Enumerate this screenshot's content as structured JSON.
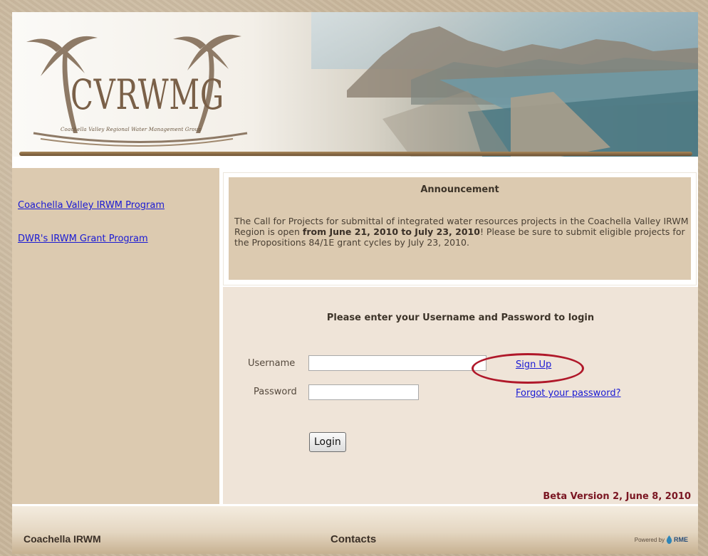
{
  "header": {
    "logo_text": "CVRWMG",
    "logo_subtitle": "Coachella Valley Regional Water Management Group"
  },
  "sidebar": {
    "links": [
      {
        "label": "Coachella Valley IRWM Program"
      },
      {
        "label": "DWR's IRWM Grant Program"
      }
    ]
  },
  "announcement": {
    "title": "Announcement",
    "text_before": "The Call for Projects for submittal of integrated water resources projects in the Coachella Valley IRWM Region is open ",
    "text_bold": "from June 21, 2010 to July 23, 2010",
    "text_after": "! Please be sure to submit eligible projects for the Propositions 84/1E grant cycles by July 23, 2010."
  },
  "login": {
    "prompt": "Please enter your Username and Password to login",
    "username_label": "Username",
    "username_value": "",
    "password_label": "Password",
    "password_value": "",
    "signup_link": "Sign Up",
    "forgot_link": "Forgot your password?",
    "login_button": "Login",
    "version": "Beta Version 2, June 8, 2010",
    "highlight_color": "#b0182a"
  },
  "footer": {
    "left_text": "Coachella IRWM",
    "center_text": "Contacts",
    "powered_by": "Powered by",
    "powered_brand": "RME",
    "powered_icon": "water-drop-icon"
  },
  "colors": {
    "link": "#1a1ad4",
    "panel": "#dccab0",
    "login_bg": "#efe4d8",
    "version": "#7a1622"
  }
}
